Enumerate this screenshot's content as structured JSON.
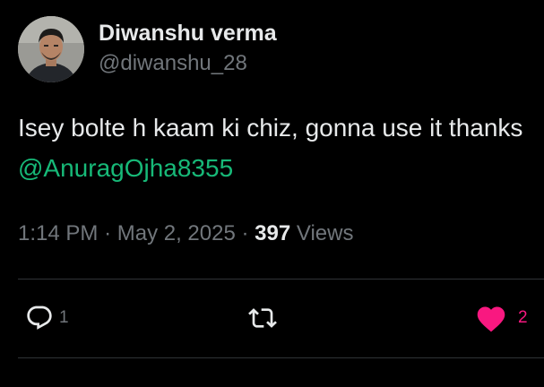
{
  "author": {
    "display_name": "Diwanshu verma",
    "handle": "@diwanshu_28"
  },
  "tweet": {
    "text_before_mention": "Isey bolte h kaam ki chiz, gonna use it thanks ",
    "mention": "@AnuragOjha8355",
    "time": "1:14 PM",
    "separator": "·",
    "date": "May 2, 2025",
    "views_count": "397",
    "views_label": "Views"
  },
  "actions": {
    "reply_count": "1",
    "retweet_count": "",
    "like_count": "2",
    "liked": true
  },
  "colors": {
    "background": "#000000",
    "text_primary": "#e7e9ea",
    "text_secondary": "#71767b",
    "mention": "#17b978",
    "like": "#f91880",
    "divider": "#2f3336"
  },
  "icons": {
    "reply": "reply-icon",
    "retweet": "retweet-icon",
    "like": "heart-icon"
  }
}
